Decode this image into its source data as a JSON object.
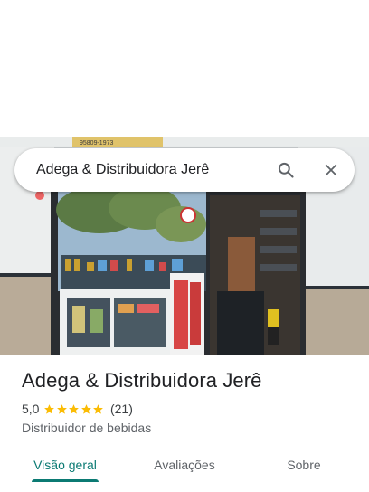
{
  "hero": {
    "storefront_sign": "95809-1973"
  },
  "search": {
    "query": "Adega & Distribuidora Jerê",
    "search_icon": "search-icon",
    "close_icon": "close-icon"
  },
  "place": {
    "name": "Adega & Distribuidora Jerê",
    "rating": "5,0",
    "stars": 5,
    "review_count": "(21)",
    "category": "Distribuidor de bebidas"
  },
  "tabs": [
    {
      "label": "Visão geral",
      "active": true
    },
    {
      "label": "Avaliações",
      "active": false
    },
    {
      "label": "Sobre",
      "active": false
    }
  ],
  "colors": {
    "accent": "#0b7a73",
    "star": "#fbbc04",
    "text_primary": "#202124",
    "text_secondary": "#5f6368"
  }
}
